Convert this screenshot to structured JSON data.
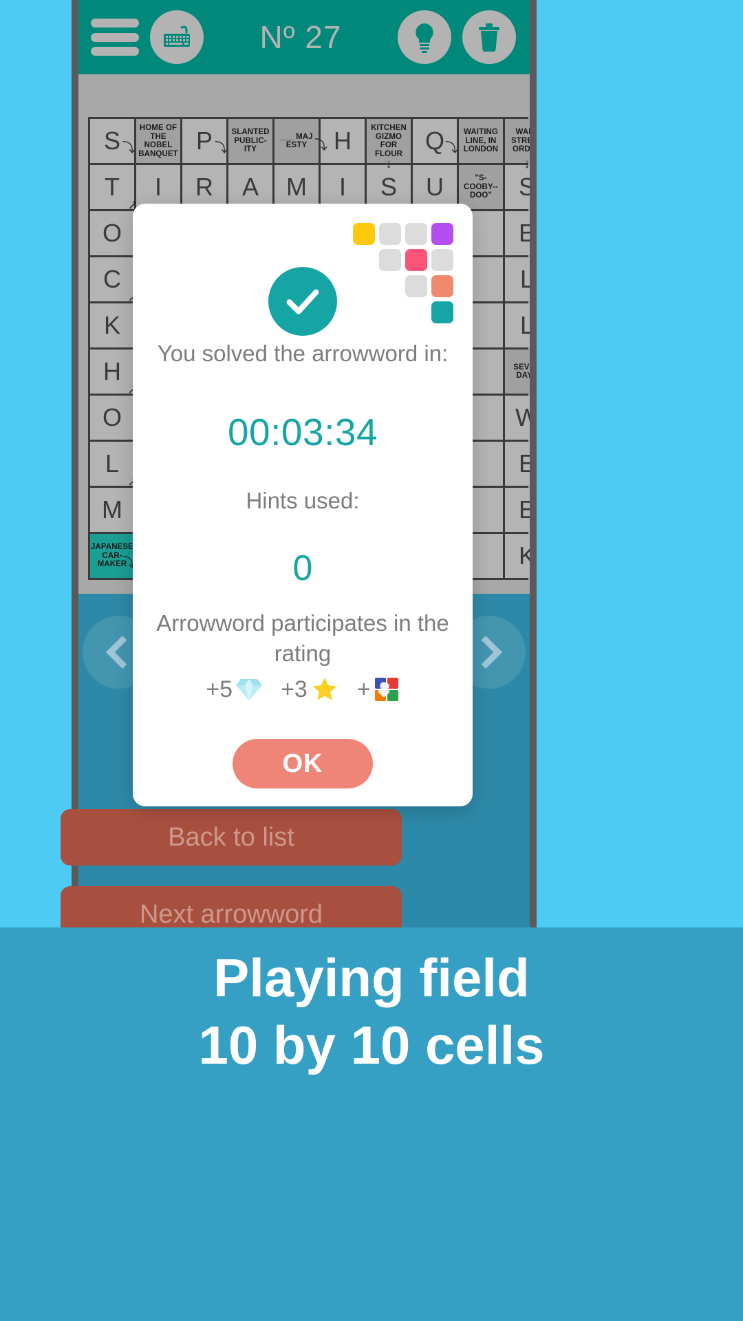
{
  "header": {
    "menu_icon": "hamburger-menu-icon",
    "keyboard_icon": "keyboard-icon",
    "title": "Nº 27",
    "hint_icon": "lightbulb-icon",
    "delete_icon": "trash-icon"
  },
  "grid": {
    "rows": 10,
    "cols": 10,
    "cells": [
      {
        "type": "letter",
        "text": "S",
        "arrow": "r-down"
      },
      {
        "type": "clue",
        "text": "HOME OF THE NOBEL BANQUET"
      },
      {
        "type": "letter",
        "text": "P",
        "arrow": "r-down"
      },
      {
        "type": "clue",
        "text": "SLANTED PUBLIC-ITY"
      },
      {
        "type": "clue",
        "text": "___ MAJ ESTY"
      },
      {
        "type": "letter",
        "text": "H",
        "arrow": "side-down"
      },
      {
        "type": "clue",
        "text": "KITCHEN GIZMO FOR FLOUR"
      },
      {
        "type": "letter",
        "text": "Q",
        "arrow": "r-down"
      },
      {
        "type": "clue",
        "text": "WAITING LINE, IN LONDON"
      },
      {
        "type": "clue",
        "text": "WALL STREET ORDER"
      },
      {
        "type": "letter",
        "text": "T",
        "arrow": "b-right"
      },
      {
        "type": "letter",
        "text": "I"
      },
      {
        "type": "letter",
        "text": "R"
      },
      {
        "type": "letter",
        "text": "A"
      },
      {
        "type": "letter",
        "text": "M"
      },
      {
        "type": "letter",
        "text": "I"
      },
      {
        "type": "letter",
        "text": "S",
        "arrow": "b-down"
      },
      {
        "type": "letter",
        "text": "U"
      },
      {
        "type": "clue",
        "text": "\"S-COOBY--DOO\""
      },
      {
        "type": "letter",
        "text": "S",
        "arrow": "b-down"
      },
      {
        "type": "letter",
        "text": "O"
      },
      {
        "type": "empty"
      },
      {
        "type": "empty"
      },
      {
        "type": "empty"
      },
      {
        "type": "empty"
      },
      {
        "type": "empty"
      },
      {
        "type": "empty"
      },
      {
        "type": "empty"
      },
      {
        "type": "empty"
      },
      {
        "type": "letter",
        "text": "E"
      },
      {
        "type": "letter",
        "text": "C",
        "arrow": "b-right"
      },
      {
        "type": "empty"
      },
      {
        "type": "empty"
      },
      {
        "type": "empty"
      },
      {
        "type": "empty"
      },
      {
        "type": "empty"
      },
      {
        "type": "empty"
      },
      {
        "type": "empty"
      },
      {
        "type": "empty"
      },
      {
        "type": "letter",
        "text": "L"
      },
      {
        "type": "letter",
        "text": "K"
      },
      {
        "type": "empty"
      },
      {
        "type": "empty"
      },
      {
        "type": "empty"
      },
      {
        "type": "empty"
      },
      {
        "type": "empty"
      },
      {
        "type": "empty"
      },
      {
        "type": "empty"
      },
      {
        "type": "empty"
      },
      {
        "type": "letter",
        "text": "L"
      },
      {
        "type": "letter",
        "text": "H",
        "arrow": "b-right"
      },
      {
        "type": "empty"
      },
      {
        "type": "empty"
      },
      {
        "type": "empty"
      },
      {
        "type": "empty"
      },
      {
        "type": "empty"
      },
      {
        "type": "empty"
      },
      {
        "type": "empty"
      },
      {
        "type": "empty"
      },
      {
        "type": "clue",
        "text": "SEVEN DAYS"
      },
      {
        "type": "letter",
        "text": "O"
      },
      {
        "type": "empty"
      },
      {
        "type": "empty"
      },
      {
        "type": "empty"
      },
      {
        "type": "empty"
      },
      {
        "type": "empty"
      },
      {
        "type": "empty"
      },
      {
        "type": "empty"
      },
      {
        "type": "empty"
      },
      {
        "type": "letter",
        "text": "W"
      },
      {
        "type": "letter",
        "text": "L",
        "arrow": "b-right"
      },
      {
        "type": "empty"
      },
      {
        "type": "empty"
      },
      {
        "type": "empty"
      },
      {
        "type": "empty"
      },
      {
        "type": "empty"
      },
      {
        "type": "empty"
      },
      {
        "type": "empty"
      },
      {
        "type": "empty"
      },
      {
        "type": "letter",
        "text": "E"
      },
      {
        "type": "letter",
        "text": "M"
      },
      {
        "type": "empty"
      },
      {
        "type": "empty"
      },
      {
        "type": "empty"
      },
      {
        "type": "empty"
      },
      {
        "type": "empty"
      },
      {
        "type": "empty"
      },
      {
        "type": "empty"
      },
      {
        "type": "empty"
      },
      {
        "type": "letter",
        "text": "E"
      },
      {
        "type": "clue",
        "teal": true,
        "text": "JAPANESE CAR- MAKER",
        "arrow": "r-down"
      },
      {
        "type": "empty"
      },
      {
        "type": "empty"
      },
      {
        "type": "empty"
      },
      {
        "type": "empty"
      },
      {
        "type": "empty"
      },
      {
        "type": "empty"
      },
      {
        "type": "empty"
      },
      {
        "type": "empty"
      },
      {
        "type": "letter",
        "text": "K"
      }
    ]
  },
  "nav": {
    "prev_icon": "chevron-left-icon",
    "next_icon": "chevron-right-icon"
  },
  "modal": {
    "logo_icon": "app-logo-blocks",
    "check_icon": "checkmark-icon",
    "solved_text": "You solved the arrowword in:",
    "time": "00:03:34",
    "hints_label": "Hints used:",
    "hints_value": "0",
    "rating_text": "Arrowword participates in the rating",
    "rewards": [
      {
        "amount": "+5",
        "icon": "diamond-icon"
      },
      {
        "amount": "+3",
        "icon": "star-icon"
      },
      {
        "amount": "+",
        "icon": "puzzle-piece-icon"
      }
    ],
    "ok_label": "OK"
  },
  "buttons": {
    "back_to_list": "Back to list",
    "next_arrowword": "Next arrowword"
  },
  "banner": {
    "line1": "Playing field",
    "line2": "10 by 10 cells"
  },
  "colors": {
    "teal": "#00897b",
    "accent_teal": "#15a5a5",
    "salmon": "#ef8576",
    "brick": "#a8503f",
    "banner_blue": "#35a0c4",
    "page_blue": "#4ecbf5"
  }
}
